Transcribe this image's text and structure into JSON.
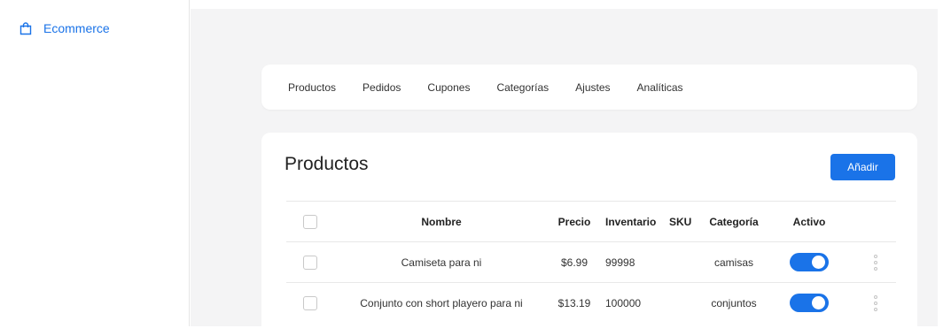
{
  "sidebar": {
    "brand_label": "Ecommerce"
  },
  "tabs": [
    {
      "label": "Productos"
    },
    {
      "label": "Pedidos"
    },
    {
      "label": "Cupones"
    },
    {
      "label": "Categorías"
    },
    {
      "label": "Ajustes"
    },
    {
      "label": "Analíticas"
    }
  ],
  "panel": {
    "title": "Productos",
    "add_label": "Añadir"
  },
  "table": {
    "headers": {
      "name": "Nombre",
      "price": "Precio",
      "inventory": "Inventario",
      "sku": "SKU",
      "category": "Categoría",
      "active": "Activo"
    },
    "rows": [
      {
        "name": "Camiseta para ni",
        "price": "$6.99",
        "inventory": "99998",
        "sku": "",
        "category": "camisas",
        "active": true
      },
      {
        "name": "Conjunto con short playero para ni",
        "price": "$13.19",
        "inventory": "100000",
        "sku": "",
        "category": "conjuntos",
        "active": true
      }
    ]
  },
  "colors": {
    "accent": "#1a73e8",
    "background": "#f4f4f5"
  }
}
